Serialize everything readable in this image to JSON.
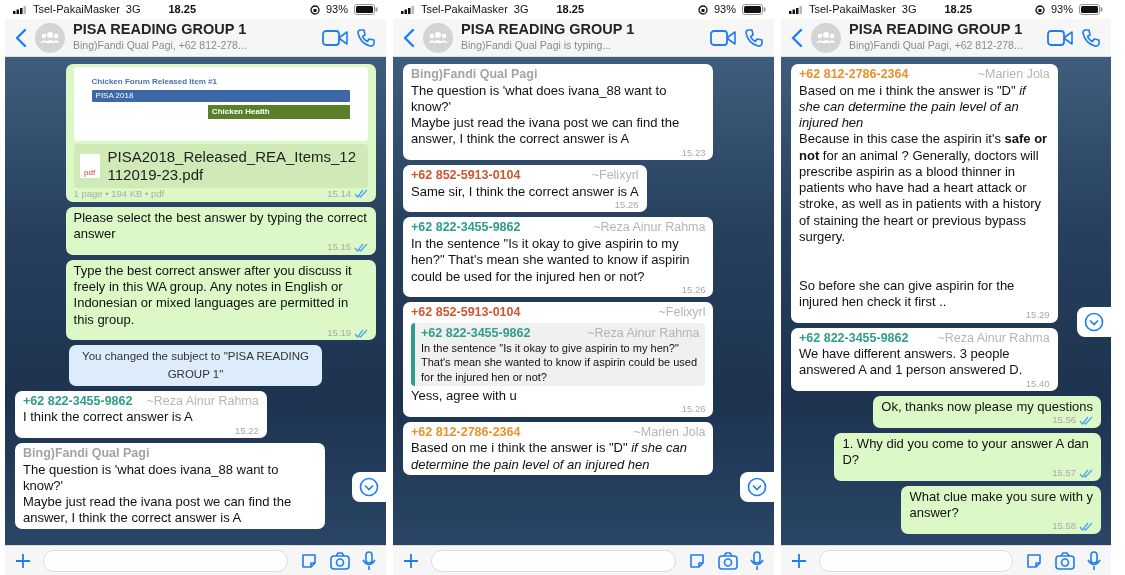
{
  "phones": [
    {
      "status_bar": {
        "carrier": "Tsel-PakaiMasker",
        "network": "3G",
        "time": "18.25",
        "battery": "93%"
      },
      "header": {
        "title": "PISA READING GROUP 1",
        "subtitle": "Bing)Fandi Qual Pagi, +62 812-278..."
      },
      "messages": [
        {
          "kind": "document",
          "preview_title": "Chicken Forum Released Item #1",
          "preview_app": "PISA 2018",
          "preview_heading": "Chicken Health",
          "file_type": "pdf",
          "file_name": "PISA2018_Released_REA_Items_12112019-23.pdf",
          "meta": "1 page • 194 KB • pdf",
          "time": "15.14",
          "read": true
        },
        {
          "kind": "outgoing",
          "text": "Please select the best answer by typing the correct answer",
          "time": "15.15",
          "read": true
        },
        {
          "kind": "outgoing",
          "text": "Type the best correct answer after you discuss it freely in this WA group. Any notes in English or Indonesian or mixed languages are permitted in this group.",
          "time": "15.19",
          "read": true
        },
        {
          "kind": "system",
          "text": "You changed the subject to \"PISA READING GROUP 1\""
        },
        {
          "kind": "incoming",
          "sender": {
            "name": "+62 822-3455-9862",
            "color": "#2f9e86"
          },
          "alias": "~Reza Ainur Rahma",
          "text": "I think the correct answer is A",
          "time": "15.22"
        },
        {
          "kind": "incoming",
          "sender": {
            "name": "Bing)Fandi Qual Pagi",
            "color": "#a3a3a3"
          },
          "text": "The question is 'what does ivana_88 want to know?'\nMaybe just read the ivana post we can find the answer, I think the correct answer is A"
        }
      ]
    },
    {
      "status_bar": {
        "carrier": "Tsel-PakaiMasker",
        "network": "3G",
        "time": "18.25",
        "battery": "93%"
      },
      "header": {
        "title": "PISA READING GROUP 1",
        "subtitle": "Bing)Fandi Qual Pagi is typing..."
      },
      "messages": [
        {
          "kind": "incoming",
          "sender": {
            "name": "Bing)Fandi Qual Pagi",
            "color": "#a3a3a3"
          },
          "text": "The question is 'what does ivana_88 want to know?'\nMaybe just read the ivana post we can find the answer, I think the correct answer is A",
          "time": "15.23"
        },
        {
          "kind": "incoming",
          "sender": {
            "name": "+62 852-5913-0104",
            "color": "#d0562f"
          },
          "alias": "~Felixyrl",
          "text": "Same sir, I think the correct answer is A",
          "time": "15.26"
        },
        {
          "kind": "incoming",
          "sender": {
            "name": "+62 822-3455-9862",
            "color": "#2f9e86"
          },
          "alias": "~Reza Ainur Rahma",
          "text": "In the sentence \"Is it okay to give aspirin to my hen?\" That's mean she wanted to know if aspirin could be used for the injured hen or not?",
          "time": "15.26"
        },
        {
          "kind": "incoming",
          "sender": {
            "name": "+62 852-5913-0104",
            "color": "#d0562f"
          },
          "alias": "~Felixyrl",
          "quote": {
            "sender": {
              "name": "+62 822-3455-9862",
              "color": "#2f9e86"
            },
            "alias": "~Reza Ainur Rahma",
            "text": "In the sentence \"Is it okay to give aspirin to my hen?\" That's mean she wanted to know if aspirin could be used for the injured hen or not?"
          },
          "text": "Yess, agree with u",
          "time": "15.26"
        },
        {
          "kind": "incoming",
          "sender": {
            "name": "+62 812-2786-2364",
            "color": "#e8922e"
          },
          "alias": "~Marien Jola",
          "text": "Based on me i think the answer is \"D\" *if she can determine the pain level of an injured hen*"
        }
      ]
    },
    {
      "status_bar": {
        "carrier": "Tsel-PakaiMasker",
        "network": "3G",
        "time": "18.25",
        "battery": "93%"
      },
      "header": {
        "title": "PISA READING GROUP 1",
        "subtitle": "Bing)Fandi Qual Pagi, +62 812-278..."
      },
      "messages": [
        {
          "kind": "incoming",
          "sender": {
            "name": "+62 812-2786-2364",
            "color": "#e8922e"
          },
          "alias": "~Marien Jola",
          "text": "Based on me i think the answer is \"D\" *if she can determine the pain level of an injured hen*\nBecause in this case the aspirin it's **safe or not** for an animal ? Generally, doctors will prescribe aspirin as a blood thinner in patients who have had a heart attack or stroke, as well as in patients with a history of staining the heart or previous bypass surgery.\n\n\nSo before she can give aspirin for the injured hen check it first ..",
          "time": "15.29"
        },
        {
          "kind": "incoming",
          "sender": {
            "name": "+62 822-3455-9862",
            "color": "#2f9e86"
          },
          "alias": "~Reza Ainur Rahma",
          "text": "We have different answers. 3 people answered A and 1 person answered D.",
          "time": "15.40"
        },
        {
          "kind": "outgoing",
          "text": "Ok, thanks now please my questions",
          "time": "15.56",
          "read": true
        },
        {
          "kind": "outgoing",
          "text": "1. Why did you come to your answer A dan D?",
          "time": "15.57",
          "read": true
        },
        {
          "kind": "outgoing",
          "text": "What clue make you sure with y\nanswer?",
          "time": "15.58",
          "read": true
        }
      ]
    }
  ]
}
